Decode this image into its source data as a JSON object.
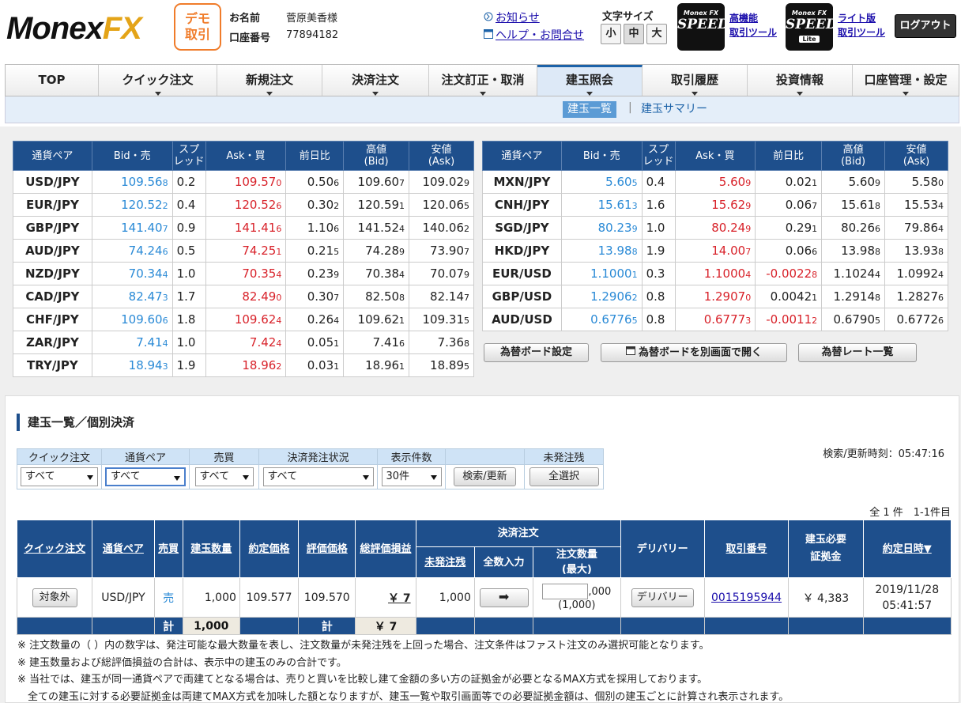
{
  "header": {
    "logo_main": "Monex",
    "logo_fx": "FX",
    "demo_badge": [
      "デモ",
      "取引"
    ],
    "name_label": "お名前",
    "name_value": "菅原美香様",
    "account_label": "口座番号",
    "account_value": "77894182",
    "news_link": "お知らせ",
    "help_link": "ヘルプ・お問合せ",
    "font_size_label": "文字サイズ",
    "font_sizes": [
      "小",
      "中",
      "大"
    ],
    "speed_brand": "Monex FX",
    "speed_label": "SPEED",
    "speed_lite_label": "Lite",
    "hi_tool_link": [
      "高機能",
      "取引ツール"
    ],
    "lite_tool_link": [
      "ライト版",
      "取引ツール"
    ],
    "logout": "ログアウト"
  },
  "nav": {
    "tabs": [
      "TOP",
      "クイック注文",
      "新規注文",
      "決済注文",
      "注文訂正・取消",
      "建玉照会",
      "取引履歴",
      "投資情報",
      "口座管理・設定"
    ],
    "active_index": 5,
    "sub_items": [
      "建玉一覧",
      "建玉サマリー"
    ]
  },
  "rates": {
    "headers": [
      "通貨ペア",
      "Bid・売",
      "スプ\nレッド",
      "Ask・買",
      "前日比",
      "高値\n(Bid)",
      "安値\n(Ask)"
    ],
    "left": [
      {
        "pair": "USD/JPY",
        "bid": "109.568",
        "spread": "0.2",
        "ask": "109.570",
        "change": "0.506",
        "high": "109.607",
        "low": "109.029"
      },
      {
        "pair": "EUR/JPY",
        "bid": "120.522",
        "spread": "0.4",
        "ask": "120.526",
        "change": "0.302",
        "high": "120.591",
        "low": "120.065"
      },
      {
        "pair": "GBP/JPY",
        "bid": "141.407",
        "spread": "0.9",
        "ask": "141.416",
        "change": "1.106",
        "high": "141.524",
        "low": "140.062"
      },
      {
        "pair": "AUD/JPY",
        "bid": "74.246",
        "spread": "0.5",
        "ask": "74.251",
        "change": "0.215",
        "high": "74.289",
        "low": "73.907"
      },
      {
        "pair": "NZD/JPY",
        "bid": "70.344",
        "spread": "1.0",
        "ask": "70.354",
        "change": "0.239",
        "high": "70.384",
        "low": "70.079"
      },
      {
        "pair": "CAD/JPY",
        "bid": "82.473",
        "spread": "1.7",
        "ask": "82.490",
        "change": "0.307",
        "high": "82.508",
        "low": "82.147"
      },
      {
        "pair": "CHF/JPY",
        "bid": "109.606",
        "spread": "1.8",
        "ask": "109.624",
        "change": "0.264",
        "high": "109.621",
        "low": "109.315"
      },
      {
        "pair": "ZAR/JPY",
        "bid": "7.414",
        "spread": "1.0",
        "ask": "7.424",
        "change": "0.051",
        "high": "7.416",
        "low": "7.368"
      },
      {
        "pair": "TRY/JPY",
        "bid": "18.943",
        "spread": "1.9",
        "ask": "18.962",
        "change": "0.031",
        "high": "18.961",
        "low": "18.895"
      }
    ],
    "right": [
      {
        "pair": "MXN/JPY",
        "bid": "5.605",
        "spread": "0.4",
        "ask": "5.609",
        "change": "0.021",
        "high": "5.609",
        "low": "5.580"
      },
      {
        "pair": "CNH/JPY",
        "bid": "15.613",
        "spread": "1.6",
        "ask": "15.629",
        "change": "0.067",
        "high": "15.618",
        "low": "15.534"
      },
      {
        "pair": "SGD/JPY",
        "bid": "80.239",
        "spread": "1.0",
        "ask": "80.249",
        "change": "0.291",
        "high": "80.266",
        "low": "79.864"
      },
      {
        "pair": "HKD/JPY",
        "bid": "13.988",
        "spread": "1.9",
        "ask": "14.007",
        "change": "0.066",
        "high": "13.988",
        "low": "13.938"
      },
      {
        "pair": "EUR/USD",
        "bid": "1.10001",
        "spread": "0.3",
        "ask": "1.10004",
        "change": "-0.00228",
        "high": "1.10244",
        "low": "1.09924"
      },
      {
        "pair": "GBP/USD",
        "bid": "1.29062",
        "spread": "0.8",
        "ask": "1.29070",
        "change": "0.00421",
        "high": "1.29148",
        "low": "1.28276"
      },
      {
        "pair": "AUD/USD",
        "bid": "0.67765",
        "spread": "0.8",
        "ask": "0.67773",
        "change": "-0.00112",
        "high": "0.67905",
        "low": "0.67726"
      }
    ],
    "buttons": [
      "為替ボード設定",
      "為替ボードを別画面で開く",
      "為替レート一覧"
    ]
  },
  "positions": {
    "title": "建玉一覧／個別決済",
    "search_time": "検索/更新時刻：05:47:16",
    "filters": {
      "headers": [
        "クイック注文",
        "通貨ペア",
        "売買",
        "決済発注状況",
        "表示件数",
        "",
        "未発注残"
      ],
      "values": [
        "すべて",
        "すべて",
        "すべて",
        "すべて",
        "30件"
      ],
      "search_button": "検索/更新",
      "select_all_button": "全選択"
    },
    "count": "全 1 件　1-1件目",
    "table": {
      "headers": {
        "quick": "クイック注文",
        "pair": "通貨ペア",
        "side": "売買",
        "qty": "建玉数量",
        "price": "約定価格",
        "eval_price": "評価価格",
        "pl": "総評価損益",
        "settle_group": "決済注文",
        "unordered": "未発注残",
        "all_input": "全数入力",
        "order_qty": "注文数量\n(最大)",
        "delivery": "デリバリー",
        "trade_no": "取引番号",
        "margin": "建玉必要\n証拠金",
        "date": "約定日時▼"
      },
      "row": {
        "quick": "対象外",
        "pair": "USD/JPY",
        "side": "売",
        "qty": "1,000",
        "price": "109.577",
        "eval_price": "109.570",
        "pl": "￥ 7",
        "unordered": "1,000",
        "arrow": "➡",
        "order_qty_suffix": ",000",
        "order_qty_max": "(1,000)",
        "delivery": "デリバリー",
        "trade_no": "0015195944",
        "margin": "￥ 4,383",
        "date": "2019/11/28",
        "time": "05:41:57"
      },
      "total": {
        "label1": "計",
        "qty": "1,000",
        "label2": "計",
        "pl": "￥ 7"
      }
    },
    "notes": [
      "※ 注文数量の（ ）内の数字は、発注可能な最大数量を表し、注文数量が未発注残を上回った場合、注文条件はファスト注文のみ選択可能となります。",
      "※ 建玉数量および総評価損益の合計は、表示中の建玉のみの合計です。",
      "※ 当社では、建玉が同一通貨ペアで両建てとなる場合は、売りと買いを比較し建て金額の多い方の証拠金が必要となるMAX方式を採用しております。",
      "　全ての建玉に対する必要証拠金は両建てMAX方式を加味した額となりますが、建玉一覧や取引画面等での必要証拠金額は、個別の建玉ごとに計算され表示されます。"
    ]
  },
  "colors": {
    "navy": "#1e4f8c",
    "bid": "#2a8ad6",
    "ask": "#d8222a",
    "accent_orange": "#f07c2a",
    "logo_gold": "#e4a418"
  }
}
